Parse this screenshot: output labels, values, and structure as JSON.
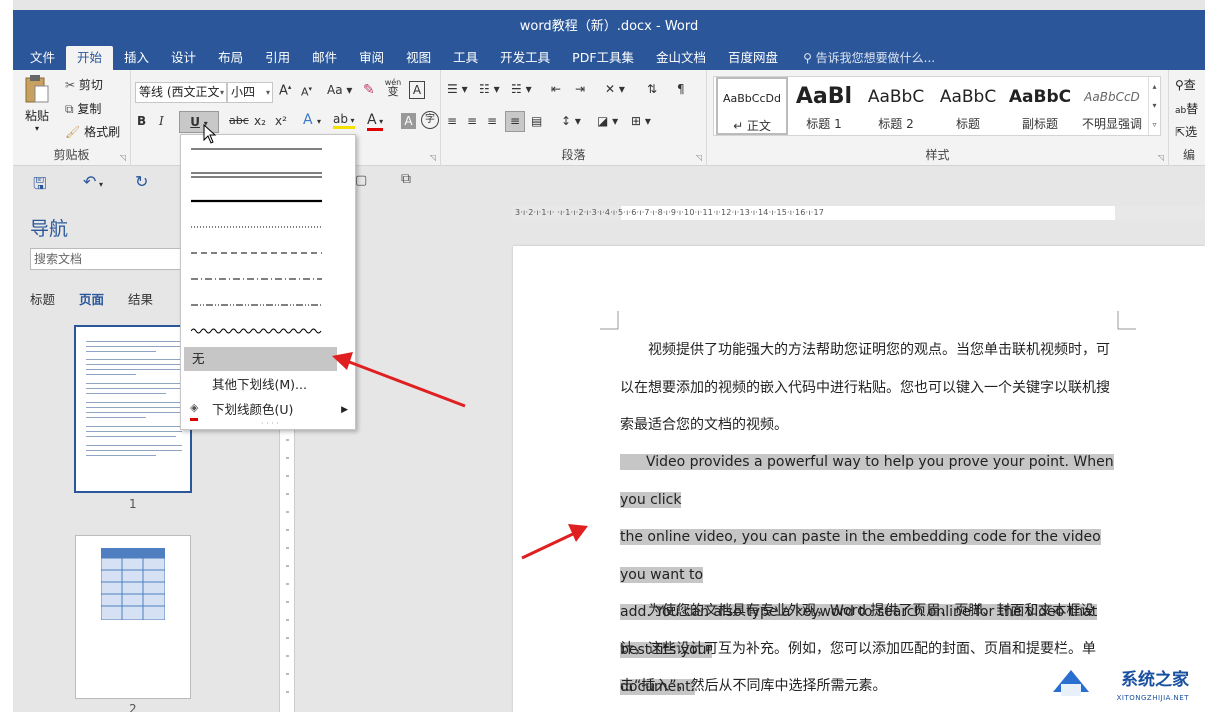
{
  "window": {
    "title": "word教程（新）.docx - Word"
  },
  "tabs": [
    "文件",
    "开始",
    "插入",
    "设计",
    "布局",
    "引用",
    "邮件",
    "审阅",
    "视图",
    "工具",
    "开发工具",
    "PDF工具集",
    "金山文档",
    "百度网盘"
  ],
  "active_tab_index": 1,
  "tell_me": "告诉我您想要做什么...",
  "clipboard": {
    "paste": "粘贴",
    "cut": "剪切",
    "copy": "复制",
    "format_painter": "格式刷",
    "label": "剪贴板"
  },
  "font": {
    "name": "等线 (西文正文",
    "size": "小四",
    "grow": "A",
    "shrink": "A",
    "case": "Aa",
    "pinyin_top": "wén",
    "pinyin_bottom": "变",
    "border_char": "A",
    "bold": "B",
    "italic": "I",
    "underline": "U",
    "strike": "abc",
    "subscript": "x₂",
    "superscript": "x²",
    "effects": "A",
    "highlight": "ab",
    "font_color": "A",
    "shade": "A",
    "circle": "字"
  },
  "paragraph": {
    "label": "段落"
  },
  "styles": {
    "label": "样式",
    "items": [
      {
        "preview": "AaBbCcDd",
        "name": "↵ 正文"
      },
      {
        "preview": "AaBl",
        "name": "标题 1"
      },
      {
        "preview": "AaBbC",
        "name": "标题 2"
      },
      {
        "preview": "AaBbC",
        "name": "标题"
      },
      {
        "preview": "AaBbC",
        "name": "副标题"
      },
      {
        "preview": "AaBbCcD",
        "name": "不明显强调"
      }
    ]
  },
  "editing": {
    "find": "查",
    "replace": "替",
    "select": "选",
    "label": "编"
  },
  "navigation": {
    "title": "导航",
    "search_placeholder": "搜索文档",
    "tabs": [
      "标题",
      "页面",
      "结果"
    ],
    "active_tab": "页面",
    "pages": [
      "1",
      "2"
    ]
  },
  "ruler": {
    "text": "3·ı·2·ı·1·ı·  ·ı·1·ı·2·ı·3·ı·4·ı·5·ı·6·ı·7·ı·8·ı·9·ı·10·ı·11·ı·12·ı·13·ı·14·ı·15·ı·16·ı·17"
  },
  "underline_menu": {
    "none": "无",
    "more": "其他下划线(M)...",
    "color": "下划线颜色(U)"
  },
  "document": {
    "p1": "视频提供了功能强大的方法帮助您证明您的观点。当您单击联机视频时，可以在想要添加的视频的嵌入代码中进行粘贴。您也可以键入一个关键字以联机搜索最适合您的文档的视频。",
    "p2_lines": [
      "Video provides a powerful way to help you prove your point. When you click",
      "the online video, you can paste in the embedding code for the video you want to",
      "add. You can also type a keyword to search online for the video that best fits your",
      "document."
    ],
    "p3": "为使您的文档具有专业外观，Word 提供了页眉、页脚、封面和文本框设计，这些设计可互为补充。例如，您可以添加匹配的封面、页眉和提要栏。单击“插入”，然后从不同库中选择所需元素。"
  },
  "watermark": {
    "name": "系统之家",
    "url": "XITONGZHIJIA.NET"
  },
  "colors": {
    "brand": "#2b579a",
    "arrow": "#e02020",
    "highlight": "#c6c6c6"
  }
}
